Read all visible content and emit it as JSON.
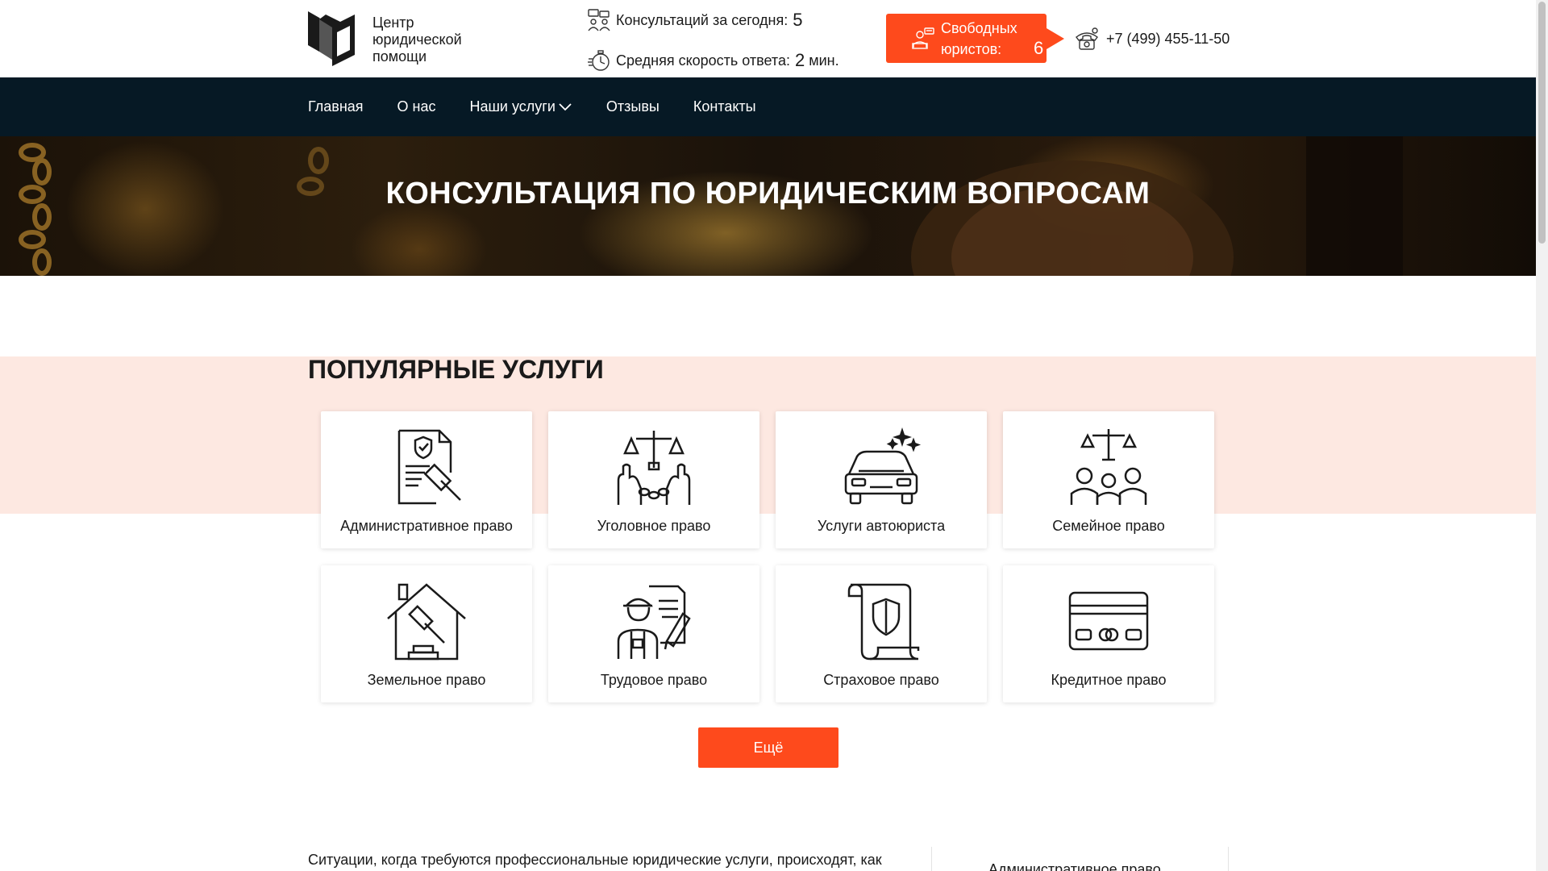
{
  "header": {
    "logo_text": "Центр юридической помощи",
    "stats": [
      {
        "label": "Консультаций за сегодня:",
        "value": "5",
        "unit": "",
        "icon": "chat-people-icon"
      },
      {
        "label": "Средняя скорость ответа:",
        "value": "2",
        "unit": "мин.",
        "icon": "stopwatch-icon"
      }
    ],
    "free_lawyers": {
      "label": "Свободных юристов:",
      "count": "6",
      "icon": "lawyer-laptop-icon"
    },
    "phone": {
      "number": "+7 (499) 455-11-50",
      "icon": "phone-icon"
    }
  },
  "nav": {
    "items": [
      "Главная",
      "О нас",
      "Наши услуги",
      "Отзывы",
      "Контакты"
    ]
  },
  "hero": {
    "title": "КОНСУЛЬТАЦИЯ ПО ЮРИДИЧЕСКИМ ВОПРОСАМ"
  },
  "services": {
    "title": "ПОПУЛЯРНЫЕ УСЛУГИ",
    "items": [
      {
        "label": "Административное право",
        "icon": "document-gavel-icon"
      },
      {
        "label": "Уголовное право",
        "icon": "handcuffs-scales-icon"
      },
      {
        "label": "Услуги автоюриста",
        "icon": "car-icon"
      },
      {
        "label": "Семейное право",
        "icon": "family-scales-icon"
      },
      {
        "label": "Земельное право",
        "icon": "house-gavel-icon"
      },
      {
        "label": "Трудовое право",
        "icon": "worker-contract-icon"
      },
      {
        "label": "Страховое право",
        "icon": "shield-scroll-icon"
      },
      {
        "label": "Кредитное право",
        "icon": "credit-card-icon"
      }
    ],
    "more_label": "Ещё"
  },
  "bottom": {
    "text": "Ситуации, когда требуются профессиональные юридические услуги, происходят, как",
    "side_item": "Административное право"
  },
  "colors": {
    "accent": "#fe4a1c",
    "nav_bg": "#061925",
    "services_bg": "#fde8e1"
  }
}
